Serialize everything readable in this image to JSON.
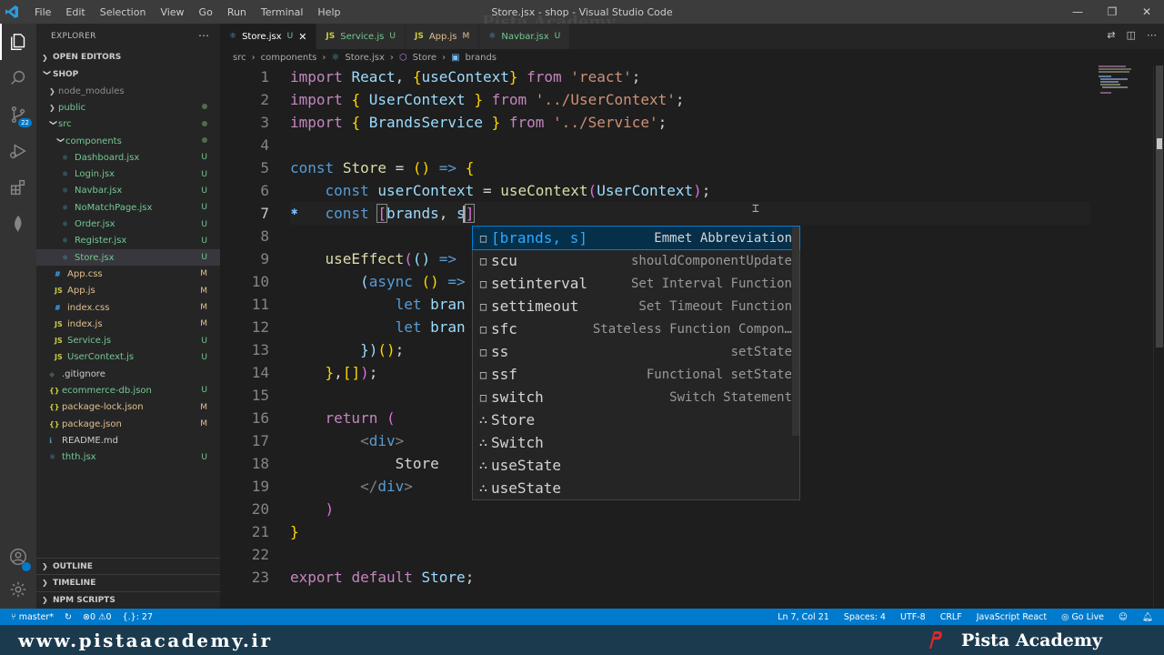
{
  "titlebar": {
    "menu": [
      "File",
      "Edit",
      "Selection",
      "View",
      "Go",
      "Run",
      "Terminal",
      "Help"
    ],
    "title": "Store.jsx - shop - Visual Studio Code",
    "watermark": "Pista Academy"
  },
  "activity": {
    "source_control_badge": "22"
  },
  "sidebar": {
    "title": "EXPLORER",
    "open_editors": "OPEN EDITORS",
    "root": "SHOP",
    "items": [
      {
        "name": "node_modules",
        "type": "folder",
        "status": ""
      },
      {
        "name": "public",
        "type": "folder",
        "status": "dot"
      },
      {
        "name": "src",
        "type": "folder",
        "status": "dot"
      },
      {
        "name": "components",
        "type": "folder",
        "status": "dot"
      },
      {
        "name": "Dashboard.jsx",
        "type": "jsx",
        "status": "U"
      },
      {
        "name": "Login.jsx",
        "type": "jsx",
        "status": "U"
      },
      {
        "name": "Navbar.jsx",
        "type": "jsx",
        "status": "U"
      },
      {
        "name": "NoMatchPage.jsx",
        "type": "jsx",
        "status": "U"
      },
      {
        "name": "Order.jsx",
        "type": "jsx",
        "status": "U"
      },
      {
        "name": "Register.jsx",
        "type": "jsx",
        "status": "U"
      },
      {
        "name": "Store.jsx",
        "type": "jsx",
        "status": "U"
      },
      {
        "name": "App.css",
        "type": "css",
        "status": "M"
      },
      {
        "name": "App.js",
        "type": "js",
        "status": "M"
      },
      {
        "name": "index.css",
        "type": "css",
        "status": "M"
      },
      {
        "name": "index.js",
        "type": "js",
        "status": "M"
      },
      {
        "name": "Service.js",
        "type": "js",
        "status": "U"
      },
      {
        "name": "UserContext.js",
        "type": "js",
        "status": "U"
      },
      {
        "name": ".gitignore",
        "type": "git",
        "status": ""
      },
      {
        "name": "ecommerce-db.json",
        "type": "json",
        "status": "U"
      },
      {
        "name": "package-lock.json",
        "type": "json",
        "status": "M"
      },
      {
        "name": "package.json",
        "type": "json",
        "status": "M"
      },
      {
        "name": "README.md",
        "type": "md",
        "status": ""
      },
      {
        "name": "thth.jsx",
        "type": "jsx",
        "status": "U"
      }
    ],
    "outline": "OUTLINE",
    "timeline": "TIMELINE",
    "npm_scripts": "NPM SCRIPTS"
  },
  "tabs": [
    {
      "label": "Store.jsx",
      "status": "U",
      "active": true
    },
    {
      "label": "Service.js",
      "status": "U",
      "active": false
    },
    {
      "label": "App.js",
      "status": "M",
      "active": false
    },
    {
      "label": "Navbar.jsx",
      "status": "U",
      "active": false
    }
  ],
  "breadcrumb": [
    "src",
    "components",
    "Store.jsx",
    "Store",
    "brands"
  ],
  "code": {
    "line_numbers": [
      "1",
      "2",
      "3",
      "4",
      "5",
      "6",
      "7",
      "8",
      "9",
      "10",
      "11",
      "12",
      "13",
      "14",
      "15",
      "16",
      "17",
      "18",
      "19",
      "20",
      "21",
      "22",
      "23"
    ],
    "current_line": 7
  },
  "suggest": [
    {
      "label": "[brands, s]",
      "detail": "Emmet Abbreviation",
      "icon": "snippet"
    },
    {
      "label": "scu",
      "detail": "shouldComponentUpdate",
      "icon": "snippet"
    },
    {
      "label": "setinterval",
      "detail": "Set Interval Function",
      "icon": "snippet"
    },
    {
      "label": "settimeout",
      "detail": "Set Timeout Function",
      "icon": "snippet"
    },
    {
      "label": "sfc",
      "detail": "Stateless Function Compon…",
      "icon": "snippet"
    },
    {
      "label": "ss",
      "detail": "setState",
      "icon": "snippet"
    },
    {
      "label": "ssf",
      "detail": "Functional setState",
      "icon": "snippet"
    },
    {
      "label": "switch",
      "detail": "Switch Statement",
      "icon": "snippet"
    },
    {
      "label": "Store",
      "detail": "",
      "icon": "symbol"
    },
    {
      "label": "Switch",
      "detail": "",
      "icon": "symbol"
    },
    {
      "label": "useState",
      "detail": "",
      "icon": "symbol"
    },
    {
      "label": "useState",
      "detail": "",
      "icon": "symbol"
    }
  ],
  "status": {
    "branch": "master*",
    "errors": "0",
    "warnings": "0",
    "selection": "{.}: 27",
    "position": "Ln 7, Col 21",
    "spaces": "Spaces: 4",
    "encoding": "UTF-8",
    "eol": "CRLF",
    "language": "JavaScript React",
    "golive": "Go Live"
  },
  "watermark": {
    "url": "www.pistaacademy.ir",
    "brand": "Pista Academy"
  }
}
